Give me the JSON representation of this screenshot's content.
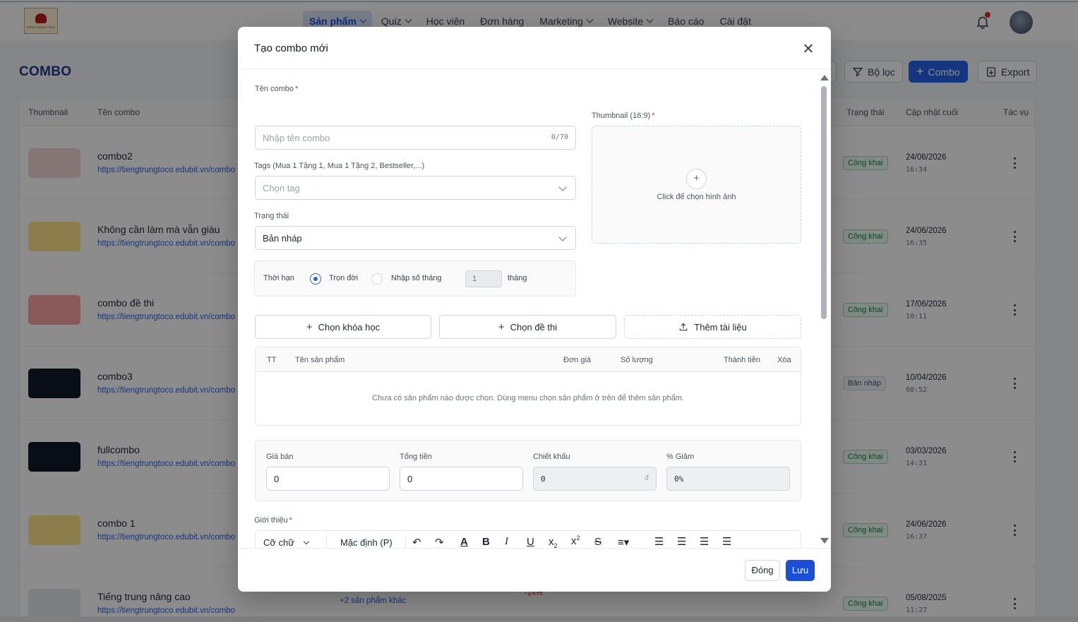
{
  "nav": {
    "items": [
      {
        "label": "Sản phẩm",
        "dropdown": true,
        "active": true
      },
      {
        "label": "Quiz",
        "dropdown": true
      },
      {
        "label": "Học viên"
      },
      {
        "label": "Đơn hàng"
      },
      {
        "label": "Marketing",
        "dropdown": true
      },
      {
        "label": "Website",
        "dropdown": true
      },
      {
        "label": "Báo cáo"
      },
      {
        "label": "Cài đặt"
      }
    ]
  },
  "page": {
    "title": "COMBO",
    "filter_label": "Bộ lọc",
    "add_label": "Combo",
    "export_label": "Export"
  },
  "table": {
    "headers": {
      "thumbnail": "Thumbnail",
      "name": "Tên combo",
      "status": "Trạng thái",
      "updated": "Cập nhật cuối",
      "actions": "Tác vụ"
    },
    "rows": [
      {
        "name": "combo2",
        "link": "https://tiengtrungtoco.edubit.vn/combo",
        "status": "Công khai",
        "date": "24/06/2026",
        "time": "16:34"
      },
      {
        "name": "Không cần làm mà vẫn giàu",
        "link": "https://tiengtrungtoco.edubit.vn/combo",
        "status": "Công khai",
        "date": "24/06/2026",
        "time": "16:35"
      },
      {
        "name": "combo đề thi",
        "link": "https://tiengtrungtoco.edubit.vn/combo",
        "status": "Công khai",
        "date": "17/06/2026",
        "time": "10:11"
      },
      {
        "name": "combo3",
        "link": "https://tiengtrungtoco.edubit.vn/combo",
        "status": "Bản nháp",
        "date": "10/04/2026",
        "time": "08:52"
      },
      {
        "name": "fullcombo",
        "link": "https://tiengtrungtoco.edubit.vn/combo",
        "status": "Công khai",
        "date": "03/03/2026",
        "time": "14:31"
      },
      {
        "name": "combo 1",
        "link": "https://tiengtrungtoco.edubit.vn/combo",
        "status": "Công khai",
        "date": "24/06/2026",
        "time": "16:37"
      },
      {
        "name": "Tiếng trung nâng cao",
        "link": "https://tiengtrungtoco.edubit.vn/combo",
        "status": "Công khai",
        "date": "05/08/2025",
        "time": "11:27"
      }
    ],
    "extra_products": "+2 sản phẩm khác",
    "discount_hint": "-14%"
  },
  "modal": {
    "title": "Tạo combo mới",
    "name_label": "Tên combo",
    "name_placeholder": "Nhập tên combo",
    "name_counter": "0/70",
    "tags_label": "Tags (Mua 1 Tặng 1, Mua 1 Tặng 2, Bestseller,...)",
    "tags_placeholder": "Chọn tag",
    "status_label": "Trạng thái",
    "status_value": "Bản nháp",
    "thumbnail_label": "Thumbnail (16:9)",
    "thumbnail_hint": "Click để chọn hình ảnh",
    "duration": {
      "label": "Thời hạn",
      "lifetime": "Trọn đời",
      "months_option": "Nhập số tháng",
      "months_value": "1",
      "months_unit": "tháng"
    },
    "buttons": {
      "choose_course": "Chọn khóa học",
      "choose_exam": "Chọn đề thi",
      "add_document": "Thêm tài liệu"
    },
    "products_table": {
      "col_index": "TT",
      "col_name": "Tên sản phẩm",
      "col_price": "Đơn giá",
      "col_qty": "Số lượng",
      "col_total": "Thành tiền",
      "col_delete": "Xóa",
      "empty": "Chưa có sản phẩm nào được chọn. Dùng menu chọn sản phẩm ở trên để thêm sản phẩm."
    },
    "pricing": {
      "sale_label": "Giá bán",
      "sale_value": "0",
      "total_label": "Tổng tiền",
      "total_value": "0",
      "discount_label": "Chiết khấu",
      "discount_value": "0",
      "currency": "đ",
      "percent_label": "% Giảm",
      "percent_value": "0%"
    },
    "intro_label": "Giới thiệu",
    "editor": {
      "font_size": "Cỡ chữ",
      "paragraph": "Mặc định (P)"
    },
    "footer": {
      "close": "Đóng",
      "save": "Lưu"
    }
  },
  "colors": {
    "primary": "#2563eb",
    "public_badge": "#15803d",
    "required": "#dc2626"
  }
}
